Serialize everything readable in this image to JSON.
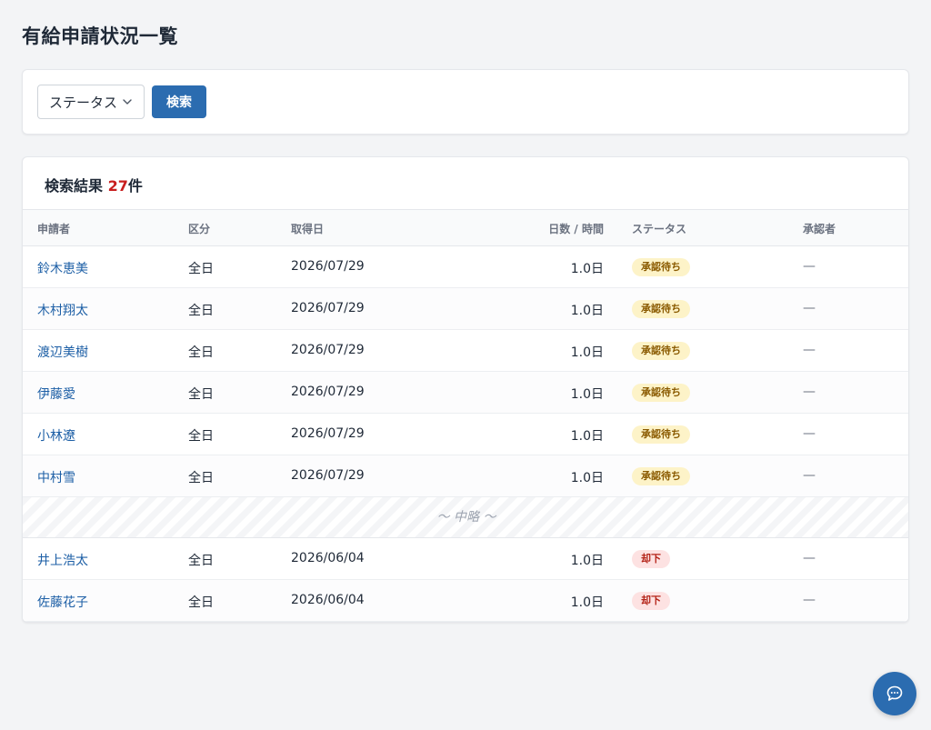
{
  "page": {
    "title": "有給申請状況一覧"
  },
  "filter": {
    "status_label": "ステータス",
    "search_label": "検索"
  },
  "results": {
    "prefix": "検索結果 ",
    "count": "27",
    "suffix": "件",
    "columns": [
      "申請者",
      "区分",
      "取得日",
      "日数 / 時間",
      "ステータス",
      "承認者"
    ],
    "rows": [
      {
        "name": "鈴木恵美",
        "category": "全日",
        "date": "2026/07/29",
        "days": "1.0日",
        "status": "承認待ち",
        "status_type": "pending",
        "approver": "—"
      },
      {
        "name": "木村翔太",
        "category": "全日",
        "date": "2026/07/29",
        "days": "1.0日",
        "status": "承認待ち",
        "status_type": "pending",
        "approver": "—"
      },
      {
        "name": "渡辺美樹",
        "category": "全日",
        "date": "2026/07/29",
        "days": "1.0日",
        "status": "承認待ち",
        "status_type": "pending",
        "approver": "—"
      },
      {
        "name": "伊藤愛",
        "category": "全日",
        "date": "2026/07/29",
        "days": "1.0日",
        "status": "承認待ち",
        "status_type": "pending",
        "approver": "—"
      },
      {
        "name": "小林遼",
        "category": "全日",
        "date": "2026/07/29",
        "days": "1.0日",
        "status": "承認待ち",
        "status_type": "pending",
        "approver": "—"
      },
      {
        "name": "中村雪",
        "category": "全日",
        "date": "2026/07/29",
        "days": "1.0日",
        "status": "承認待ち",
        "status_type": "pending",
        "approver": "—"
      },
      {
        "name": "井上浩太",
        "category": "全日",
        "date": "2026/06/04",
        "days": "1.0日",
        "status": "却下",
        "status_type": "rejected",
        "approver": "—"
      },
      {
        "name": "佐藤花子",
        "category": "全日",
        "date": "2026/06/04",
        "days": "1.0日",
        "status": "却下",
        "status_type": "rejected",
        "approver": "—"
      }
    ],
    "omitted_label": "〜 中略 〜"
  },
  "icons": {
    "select_arrow": "chevron-down-icon",
    "chat": "chat-bubble-icon"
  },
  "colors": {
    "accent": "#2b6cb0",
    "link": "#1d5fa6",
    "count": "#c81e1e",
    "pending_bg": "#fdf3c8",
    "rejected_bg": "#fde2e2"
  }
}
